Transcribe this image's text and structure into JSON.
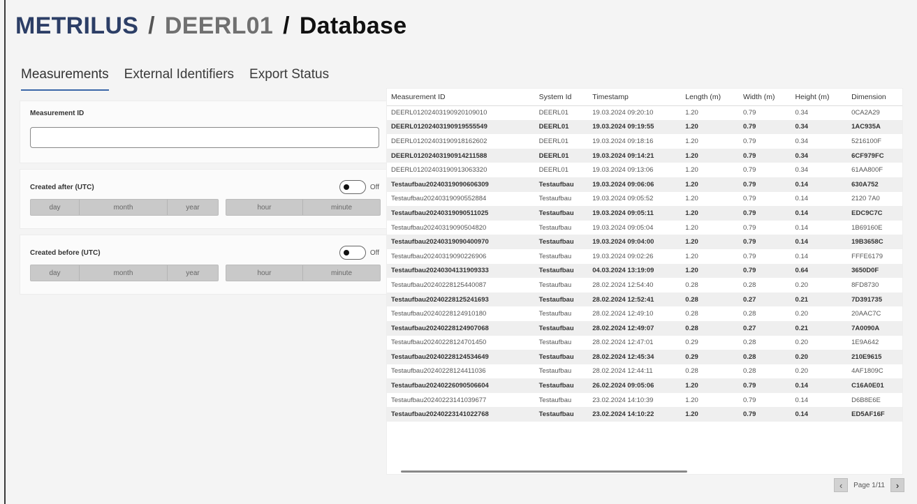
{
  "breadcrumb": {
    "brand": "METRILUS",
    "separator": "/",
    "system": "DEERL01",
    "page": "Database"
  },
  "tabs": [
    {
      "label": "Measurements",
      "active": true
    },
    {
      "label": "External Identifiers",
      "active": false
    },
    {
      "label": "Export Status",
      "active": false
    }
  ],
  "filters": {
    "measurement_id": {
      "label": "Measurement ID",
      "value": ""
    },
    "created_after": {
      "label": "Created after (UTC)",
      "toggle_state": "Off",
      "fields": {
        "day": "day",
        "month": "month",
        "year": "year",
        "hour": "hour",
        "minute": "minute"
      }
    },
    "created_before": {
      "label": "Created before (UTC)",
      "toggle_state": "Off",
      "fields": {
        "day": "day",
        "month": "month",
        "year": "year",
        "hour": "hour",
        "minute": "minute"
      }
    }
  },
  "table": {
    "columns": [
      "Measurement ID",
      "System Id",
      "Timestamp",
      "Length (m)",
      "Width (m)",
      "Height (m)",
      "Dimension"
    ],
    "rows": [
      [
        "DEERL01202403190920109010",
        "DEERL01",
        "19.03.2024 09:20:10",
        "1.20",
        "0.79",
        "0.34",
        "0CA2A29"
      ],
      [
        "DEERL01202403190919555549",
        "DEERL01",
        "19.03.2024 09:19:55",
        "1.20",
        "0.79",
        "0.34",
        "1AC935A"
      ],
      [
        "DEERL01202403190918162602",
        "DEERL01",
        "19.03.2024 09:18:16",
        "1.20",
        "0.79",
        "0.34",
        "5216100F"
      ],
      [
        "DEERL01202403190914211588",
        "DEERL01",
        "19.03.2024 09:14:21",
        "1.20",
        "0.79",
        "0.34",
        "6CF979FC"
      ],
      [
        "DEERL01202403190913063320",
        "DEERL01",
        "19.03.2024 09:13:06",
        "1.20",
        "0.79",
        "0.34",
        "61AA800F"
      ],
      [
        "Testaufbau20240319090606309",
        "Testaufbau",
        "19.03.2024 09:06:06",
        "1.20",
        "0.79",
        "0.14",
        "630A752"
      ],
      [
        "Testaufbau20240319090552884",
        "Testaufbau",
        "19.03.2024 09:05:52",
        "1.20",
        "0.79",
        "0.14",
        "2120 7A0"
      ],
      [
        "Testaufbau20240319090511025",
        "Testaufbau",
        "19.03.2024 09:05:11",
        "1.20",
        "0.79",
        "0.14",
        "EDC9C7C"
      ],
      [
        "Testaufbau20240319090504820",
        "Testaufbau",
        "19.03.2024 09:05:04",
        "1.20",
        "0.79",
        "0.14",
        "1B69160E"
      ],
      [
        "Testaufbau20240319090400970",
        "Testaufbau",
        "19.03.2024 09:04:00",
        "1.20",
        "0.79",
        "0.14",
        "19B3658C"
      ],
      [
        "Testaufbau20240319090226906",
        "Testaufbau",
        "19.03.2024 09:02:26",
        "1.20",
        "0.79",
        "0.14",
        "FFFE6179"
      ],
      [
        "Testaufbau20240304131909333",
        "Testaufbau",
        "04.03.2024 13:19:09",
        "1.20",
        "0.79",
        "0.64",
        "3650D0F"
      ],
      [
        "Testaufbau20240228125440087",
        "Testaufbau",
        "28.02.2024 12:54:40",
        "0.28",
        "0.28",
        "0.20",
        "8FD8730"
      ],
      [
        "Testaufbau20240228125241693",
        "Testaufbau",
        "28.02.2024 12:52:41",
        "0.28",
        "0.27",
        "0.21",
        "7D391735"
      ],
      [
        "Testaufbau20240228124910180",
        "Testaufbau",
        "28.02.2024 12:49:10",
        "0.28",
        "0.28",
        "0.20",
        "20AAC7C"
      ],
      [
        "Testaufbau20240228124907068",
        "Testaufbau",
        "28.02.2024 12:49:07",
        "0.28",
        "0.27",
        "0.21",
        "7A0090A"
      ],
      [
        "Testaufbau20240228124701450",
        "Testaufbau",
        "28.02.2024 12:47:01",
        "0.29",
        "0.28",
        "0.20",
        "1E9A642"
      ],
      [
        "Testaufbau20240228124534649",
        "Testaufbau",
        "28.02.2024 12:45:34",
        "0.29",
        "0.28",
        "0.20",
        "210E9615"
      ],
      [
        "Testaufbau20240228124411036",
        "Testaufbau",
        "28.02.2024 12:44:11",
        "0.28",
        "0.28",
        "0.20",
        "4AF1809C"
      ],
      [
        "Testaufbau20240226090506604",
        "Testaufbau",
        "26.02.2024 09:05:06",
        "1.20",
        "0.79",
        "0.14",
        "C16A0E01"
      ],
      [
        "Testaufbau20240223141039677",
        "Testaufbau",
        "23.02.2024 14:10:39",
        "1.20",
        "0.79",
        "0.14",
        "D6B8E6E"
      ],
      [
        "Testaufbau20240223141022768",
        "Testaufbau",
        "23.02.2024 14:10:22",
        "1.20",
        "0.79",
        "0.14",
        "ED5AF16F"
      ]
    ]
  },
  "pager": {
    "label": "Page 1/11",
    "prev": "‹",
    "next": "›"
  }
}
